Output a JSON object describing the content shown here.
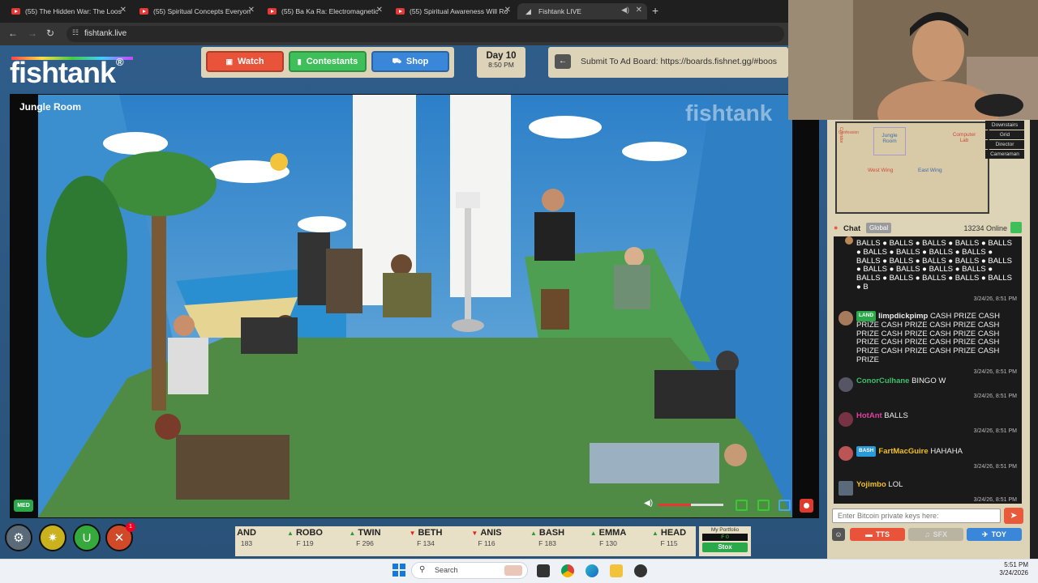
{
  "browser": {
    "tabs": [
      {
        "title": "(55) The Hidden War: The Loos",
        "type": "youtube"
      },
      {
        "title": "(55) Spiritual Concepts Everyon",
        "type": "youtube"
      },
      {
        "title": "(55) Ba Ka Ra: Electromagnetic",
        "type": "youtube"
      },
      {
        "title": "(55) Spiritual Awareness Will Ro",
        "type": "youtube"
      },
      {
        "title": "Fishtank LIVE",
        "type": "fishtank",
        "active": true
      }
    ],
    "new_tab": "+",
    "url": "fishtank.live"
  },
  "site": {
    "logo": "fishtank",
    "logo_mark": "®",
    "nav": {
      "watch": "Watch",
      "contestants": "Contestants",
      "shop": "Shop"
    },
    "day": "Day 10",
    "time": "8:50 PM",
    "ad_board": "Submit To Ad Board: https://boards.fishnet.gg/#boos",
    "room_name": "Jungle Room",
    "video_watermark": "fishtank",
    "quality_badge": "MED"
  },
  "ticker": [
    {
      "name": "AND",
      "value": "183",
      "dir": "none"
    },
    {
      "name": "ROBO",
      "value": "F 119",
      "dir": "up"
    },
    {
      "name": "TWIN",
      "value": "F 296",
      "dir": "up"
    },
    {
      "name": "BETH",
      "value": "F 134",
      "dir": "down"
    },
    {
      "name": "ANIS",
      "value": "F 116",
      "dir": "down"
    },
    {
      "name": "BASH",
      "value": "F 183",
      "dir": "up"
    },
    {
      "name": "EMMA",
      "value": "F 130",
      "dir": "up"
    },
    {
      "name": "HEAD",
      "value": "F 115",
      "dir": "up"
    }
  ],
  "portfolio": {
    "label": "My Portfolio",
    "value": "F 0",
    "button": "Stox"
  },
  "notification_count": "1",
  "map": {
    "rooms": [
      "Jungle Room",
      "Computer Lab",
      "Corridor",
      "West Wing",
      "East Wing",
      "Confession"
    ],
    "links": [
      "Downstairs",
      "Grid",
      "Director",
      "Cameraman"
    ]
  },
  "chat": {
    "label": "Chat",
    "tab": "Global",
    "online": "13234 Online",
    "messages": [
      {
        "user": "",
        "tag": "",
        "text": "BALLS ● BALLS ● BALLS ● BALLS ● BALLS ● BALLS ● BALLS ● BALLS ● BALLS ● BALLS ● BALLS ● BALLS ● BALLS ● BALLS ● BALLS ● BALLS ● BALLS ● BALLS ● BALLS ● BALLS ● BALLS ● BALLS ● BALLS ● B",
        "time": "3/24/26, 8:51 PM",
        "user_color": "#ffffff"
      },
      {
        "user": "limpdickpimp",
        "tag": "LAND",
        "tag_color": "#2aa84a",
        "text": "CASH PRIZE CASH PRIZE CASH PRIZE CASH PRIZE CASH PRIZE CASH PRIZE CASH PRIZE CASH PRIZE CASH PRIZE CASH PRIZE CASH PRIZE CASH PRIZE CASH PRIZE CASH PRIZE",
        "time": "3/24/26, 8:51 PM",
        "user_color": "#ffffff"
      },
      {
        "user": "ConorCulhane",
        "tag": "",
        "text": "BINGO W",
        "time": "3/24/26, 8:51 PM",
        "user_color": "#3cbf6a"
      },
      {
        "user": "HotAnt",
        "tag": "",
        "text": "BALLS",
        "time": "3/24/26, 8:51 PM",
        "user_color": "#e040a0"
      },
      {
        "user": "FartMacGuire",
        "tag": "BASH",
        "tag_color": "#2a9ad8",
        "text": "HAHAHA",
        "time": "3/24/26, 8:51 PM",
        "user_color": "#f0c020"
      },
      {
        "user": "Yojimbo",
        "tag": "",
        "text": "LOL",
        "time": "3/24/26, 8:51 PM",
        "user_color": "#f0c020"
      }
    ],
    "input_placeholder": "Enter Bitcoin private keys here:",
    "buttons": {
      "tts": "TTS",
      "sfx": "SFX",
      "toy": "TOY"
    }
  },
  "taskbar": {
    "search": "Search",
    "time": "5:51 PM",
    "date": "3/24/2026"
  },
  "colors": {
    "watch": "#e8533a",
    "contestants": "#3fbf5a",
    "shop": "#3a86d8",
    "page_bg": "#2d5a86",
    "panel": "#ddd3b6"
  }
}
